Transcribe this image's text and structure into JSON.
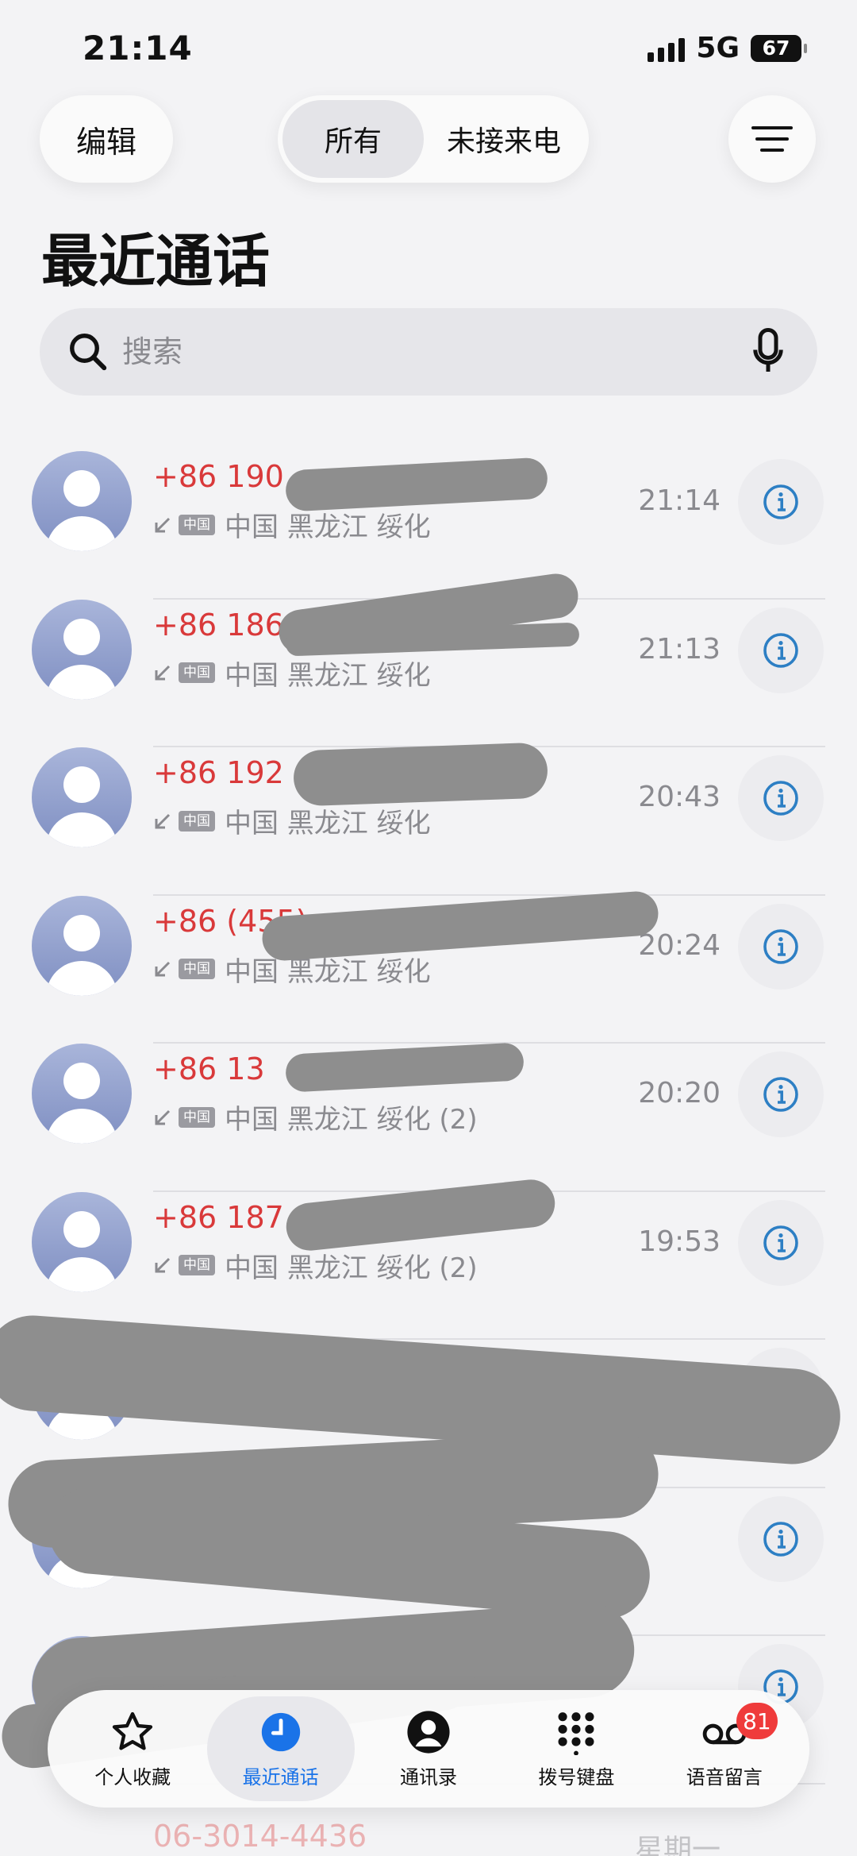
{
  "status_bar": {
    "time": "21:14",
    "network": "5G",
    "battery": "67"
  },
  "header": {
    "edit_label": "编辑",
    "filter_all": "所有",
    "filter_missed": "未接来电",
    "title": "最近通话"
  },
  "search": {
    "placeholder": "搜索"
  },
  "calls": [
    {
      "caller": "+86 190",
      "location": "中国 黑龙江 绥化",
      "time": "21:14"
    },
    {
      "caller": "+86 186",
      "location": "中国 黑龙江 绥化",
      "time": "21:13"
    },
    {
      "caller": "+86 192",
      "location": "中国 黑龙江 绥化",
      "time": "20:43"
    },
    {
      "caller": "+86 (455)",
      "location": "中国 黑龙江 绥化",
      "time": "20:24"
    },
    {
      "caller": "+86 13",
      "location": "中国 黑龙江 绥化 (2)",
      "time": "20:20"
    },
    {
      "caller": "+86 187",
      "location": "中国 黑龙江 绥化 (2)",
      "time": "19:53"
    },
    {
      "caller": "",
      "location": "",
      "time": ""
    },
    {
      "caller": "",
      "location": "",
      "time": ""
    },
    {
      "caller": "",
      "location": "",
      "time": ""
    }
  ],
  "badge_label": "中国",
  "partial_row": {
    "caller": "06-3014-4436",
    "time": "星期一"
  },
  "tabs": [
    {
      "label": "个人收藏",
      "icon": "star-icon"
    },
    {
      "label": "最近通话",
      "icon": "clock-icon"
    },
    {
      "label": "通讯录",
      "icon": "contact-icon"
    },
    {
      "label": "拨号键盘",
      "icon": "keypad-icon"
    },
    {
      "label": "语音留言",
      "icon": "voicemail-icon",
      "badge": "81"
    }
  ],
  "colors": {
    "missed_red": "#d9393a",
    "accent_blue": "#1a73e8",
    "info_blue": "#2d7fc4",
    "badge_red": "#ef3b3b"
  }
}
